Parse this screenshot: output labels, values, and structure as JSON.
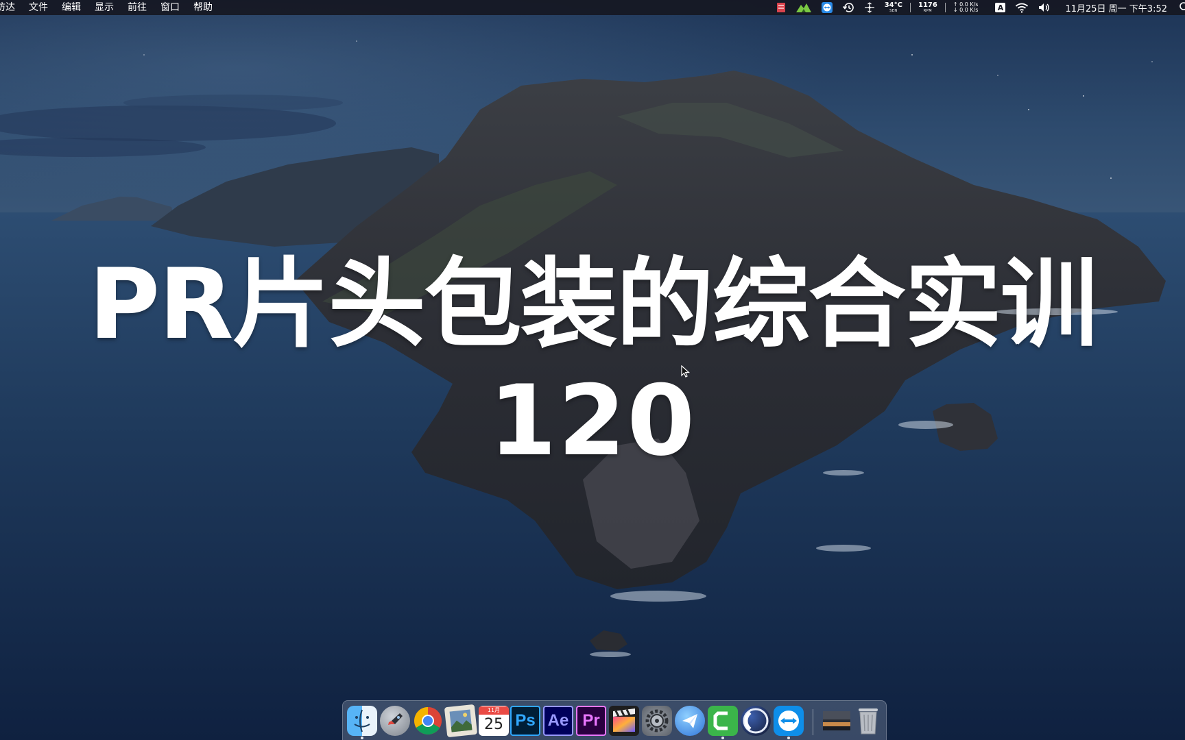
{
  "menubar": {
    "app_name": "访达",
    "menus": [
      "文件",
      "编辑",
      "显示",
      "前往",
      "窗口",
      "帮助"
    ],
    "status": {
      "temperature": "34°C",
      "temperature_label": "SEN",
      "fan_speed": "1176",
      "fan_label": "RPM",
      "net_up": "0.0 K/s",
      "net_down": "0.0 K/s",
      "input_method": "A",
      "datetime": "11月25日 周一 下午3:52"
    }
  },
  "overlay": {
    "title": "PR片头包装的综合实训",
    "number": "120"
  },
  "dock": {
    "apps": [
      "finder-icon",
      "launchpad-icon",
      "chrome-icon",
      "preview-icon",
      "calendar-icon",
      "photoshop-icon",
      "after-effects-icon",
      "premiere-icon",
      "final-cut-icon",
      "system-preferences-icon",
      "mail-icon",
      "camtasia-icon",
      "cinema4d-icon",
      "teamviewer-icon",
      "downloads-stack-icon",
      "trash-icon"
    ],
    "calendar_month": "11月",
    "calendar_day": "25",
    "ps_label": "Ps",
    "ae_label": "Ae",
    "pr_label": "Pr"
  },
  "colors": {
    "menubar_bg": "#16182a",
    "photoshop": "#31a8ff",
    "after_effects": "#9999ff",
    "premiere": "#ea77ff",
    "camtasia": "#3bb54a",
    "teamviewer": "#0e8ee9"
  }
}
